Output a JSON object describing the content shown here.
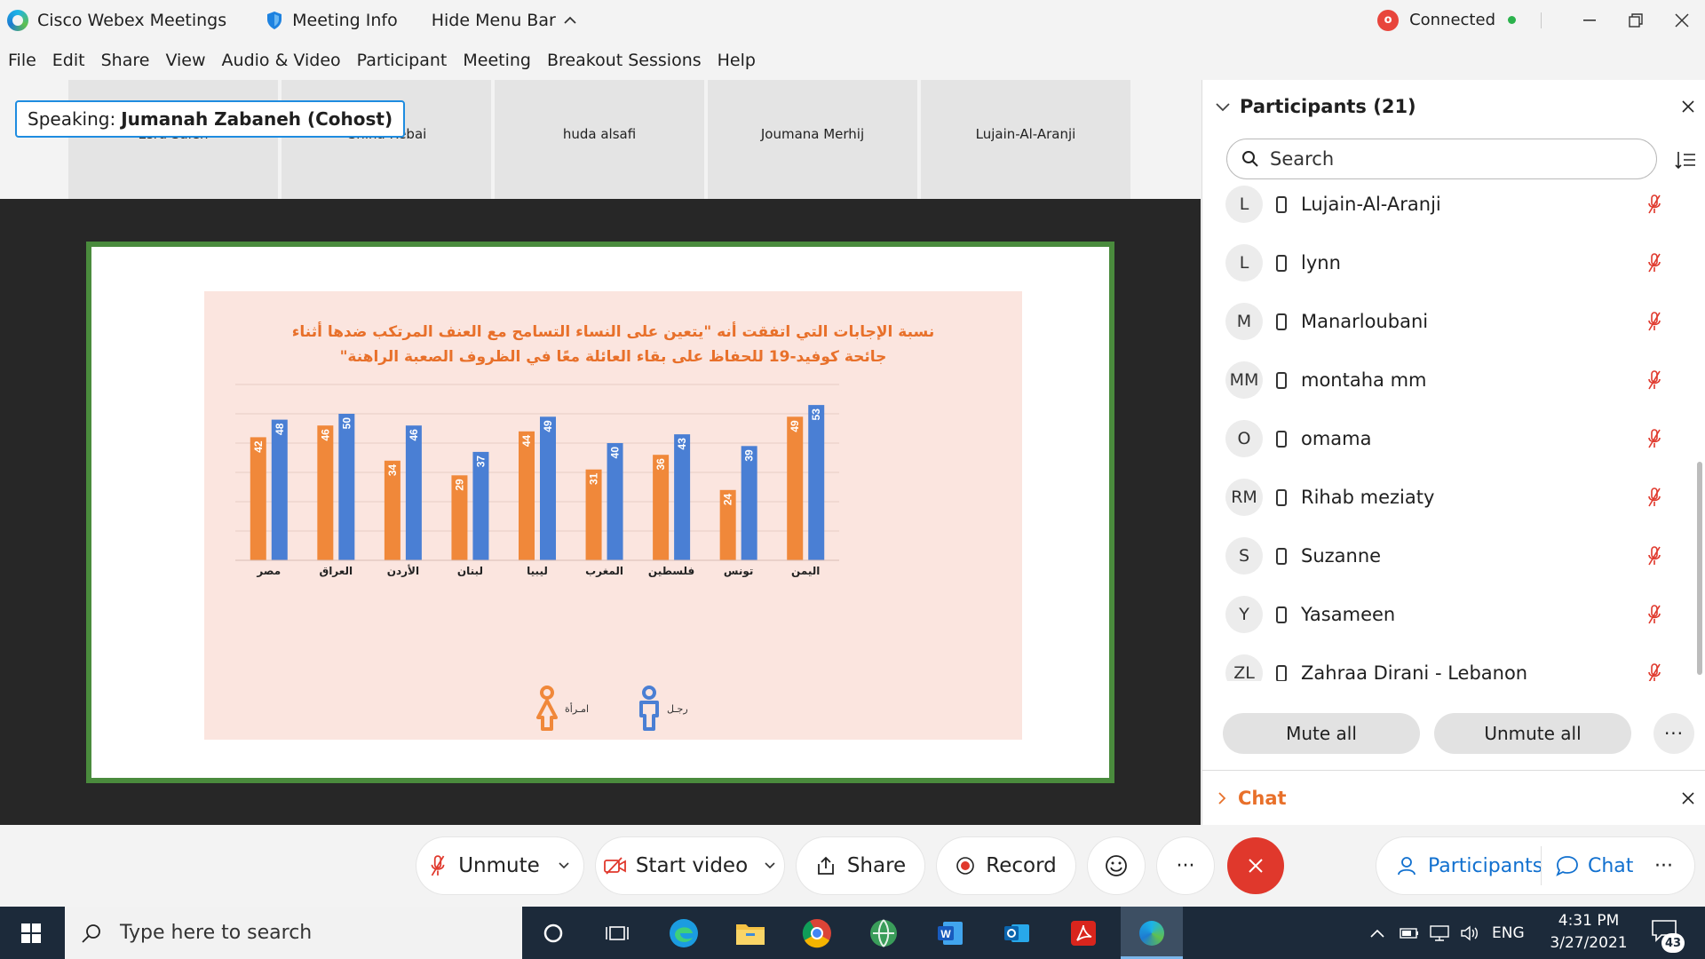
{
  "titlebar": {
    "app_name": "Cisco Webex Meetings",
    "meeting_info": "Meeting Info",
    "hide_menu_bar": "Hide Menu Bar",
    "connection_status": "Connected"
  },
  "menubar": {
    "items": [
      "File",
      "Edit",
      "Share",
      "View",
      "Audio & Video",
      "Participant",
      "Meeting",
      "Breakout Sessions",
      "Help"
    ]
  },
  "video_strip": {
    "speaking_label": "Speaking:",
    "speaking_name": "Jumanah Zabaneh (Cohost)",
    "thumbnails": [
      "Esra Saleh",
      "Ghina Rebai",
      "huda alsafi",
      "Joumana Merhij",
      "Lujain-Al-Aranji"
    ]
  },
  "slide": {
    "chart_title_line1": "نسبة الإجابات التي اتفقت أنه \"يتعين على النساء التسامح مع العنف المرتكب ضدها أثناء",
    "chart_title_line2": "جائحة كوفيد-19 للحفاظ على بقاء العائلة معًا في الظروف الصعبة الراهنة\"",
    "legend_woman": "امـرأة",
    "legend_man": "رجـل"
  },
  "chart_data": {
    "type": "bar",
    "title": "نسبة الإجابات التي اتفقت أنه \"يتعين على النساء التسامح مع العنف المرتكب ضدها أثناء جائحة كوفيد-19 للحفاظ على بقاء العائلة معًا في الظروف الصعبة الراهنة\"",
    "categories": [
      "مصر",
      "العراق",
      "الأردن",
      "لبنان",
      "ليبيا",
      "المغرب",
      "فلسطين",
      "تونس",
      "اليمن"
    ],
    "series": [
      {
        "name": "امـرأة",
        "color": "#f0883a",
        "values": [
          42,
          46,
          34,
          29,
          44,
          31,
          36,
          24,
          49
        ]
      },
      {
        "name": "رجـل",
        "color": "#4a7fd4",
        "values": [
          48,
          50,
          46,
          37,
          49,
          40,
          43,
          39,
          53
        ]
      }
    ],
    "ylim": [
      0,
      60
    ],
    "grid": true,
    "legend": "bottom-center"
  },
  "participants": {
    "header": "Participants (21)",
    "search_placeholder": "Search",
    "list": [
      {
        "initials": "L",
        "name": "Lujain-Al-Aranji"
      },
      {
        "initials": "L",
        "name": "lynn"
      },
      {
        "initials": "M",
        "name": "Manarloubani"
      },
      {
        "initials": "MM",
        "name": "montaha mm"
      },
      {
        "initials": "O",
        "name": "omama"
      },
      {
        "initials": "RM",
        "name": "Rihab meziaty"
      },
      {
        "initials": "S",
        "name": "Suzanne"
      },
      {
        "initials": "Y",
        "name": "Yasameen"
      },
      {
        "initials": "ZL",
        "name": "Zahraa Dirani - Lebanon"
      }
    ],
    "mute_all": "Mute all",
    "unmute_all": "Unmute all",
    "chat_header": "Chat"
  },
  "controls": {
    "unmute": "Unmute",
    "start_video": "Start video",
    "share": "Share",
    "record": "Record",
    "participants": "Participants",
    "chat": "Chat"
  },
  "taskbar": {
    "search_placeholder": "Type here to search",
    "language": "ENG",
    "time": "4:31 PM",
    "date": "3/27/2021",
    "notification_count": "43"
  },
  "colors": {
    "accent_orange": "#e8702a",
    "webex_blue": "#1170cf",
    "end_red": "#e0382c",
    "slide_border_green": "#4a8b3d"
  }
}
